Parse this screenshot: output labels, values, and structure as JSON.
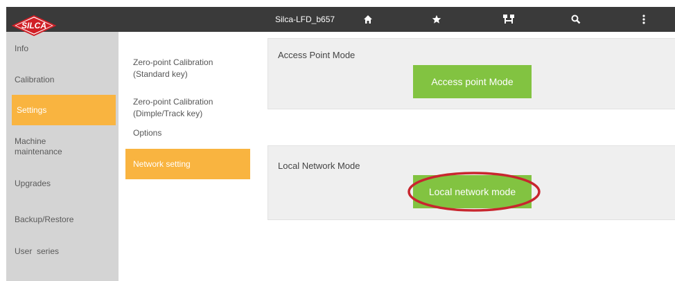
{
  "header": {
    "device_name": "Silca-LFD_b657",
    "logo_text": "SILCA",
    "icons": [
      "home-icon",
      "star-icon",
      "network-icon",
      "search-icon",
      "more-icon"
    ]
  },
  "sidebar": {
    "items": [
      {
        "label": "Info",
        "active": false
      },
      {
        "label": "Calibration",
        "active": false
      },
      {
        "label": "Settings",
        "active": true
      },
      {
        "label": "Machine\nmaintenance",
        "active": false
      },
      {
        "label": "Upgrades",
        "active": false
      },
      {
        "label": "Backup/Restore",
        "active": false
      },
      {
        "label": "User  series",
        "active": false
      }
    ]
  },
  "submenu": {
    "items": [
      {
        "label": "Zero-point Calibration\n(Standard key)",
        "active": false
      },
      {
        "label": "Zero-point Calibration\n(Dimple/Track key)",
        "active": false
      },
      {
        "label": "Options",
        "active": false
      },
      {
        "label": "Network setting",
        "active": true
      }
    ]
  },
  "main": {
    "access_point": {
      "title": "Access Point Mode",
      "button_label": "Access point Mode"
    },
    "local_network": {
      "title": "Local Network Mode",
      "button_label": "Local network mode"
    }
  },
  "colors": {
    "topbar": "#3a3a3a",
    "sidebar": "#d4d4d4",
    "accent_orange": "#f9b440",
    "button_green": "#82c341",
    "highlight_red": "#c8262e",
    "logo_red": "#d11f26"
  }
}
